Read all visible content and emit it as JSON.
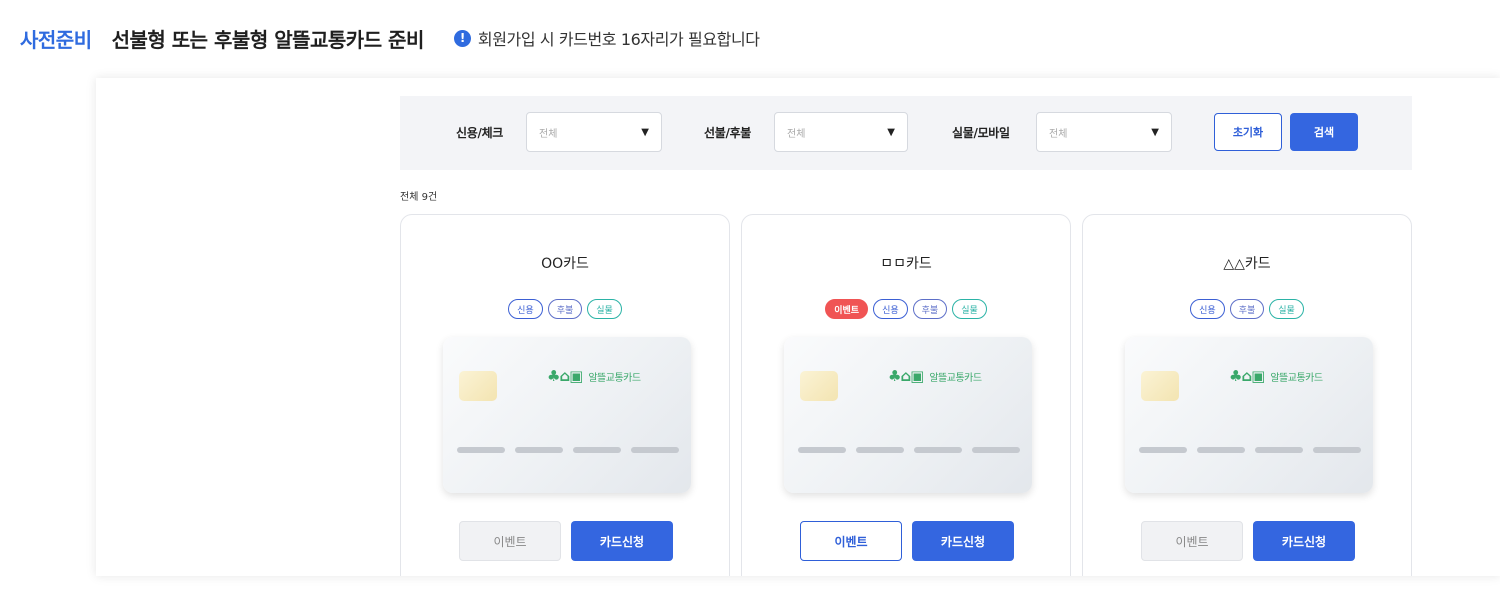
{
  "header": {
    "step": "사전준비",
    "title": "선불형 또는 후불형 알뜰교통카드 준비",
    "notice_icon": "!",
    "notice": "회원가입 시 카드번호 16자리가 필요합니다"
  },
  "filters": {
    "credit_check": {
      "label": "신용/체크",
      "value": "전체"
    },
    "prepaid_postpaid": {
      "label": "선불/후불",
      "value": "전체"
    },
    "physical_mobile": {
      "label": "실물/모바일",
      "value": "전체"
    },
    "caret": "▼",
    "reset_label": "초기화",
    "search_label": "검색"
  },
  "result_count": "전체 9건",
  "cards": [
    {
      "name": "OO카드",
      "tags": {
        "credit": "신용",
        "post": "후불",
        "phys": "실물"
      },
      "logo_text": "알뜰교통카드",
      "event_label": "이벤트",
      "apply_label": "카드신청"
    },
    {
      "name": "ㅁㅁ카드",
      "tags": {
        "event": "이벤트",
        "credit": "신용",
        "post": "후불",
        "phys": "실물"
      },
      "logo_text": "알뜰교통카드",
      "event_label": "이벤트",
      "apply_label": "카드신청"
    },
    {
      "name": "△△카드",
      "tags": {
        "credit": "신용",
        "post": "후불",
        "phys": "실물"
      },
      "logo_text": "알뜰교통카드",
      "event_label": "이벤트",
      "apply_label": "카드신청"
    }
  ],
  "colors": {
    "accent": "#2f6bdf",
    "primary_button": "#3466e0",
    "event_tag": "#f05454",
    "logo_green": "#3aa86a"
  },
  "icons": [
    "notice-info-icon",
    "dropdown-caret-icon",
    "card-chip-icon",
    "card-logo-icon"
  ]
}
